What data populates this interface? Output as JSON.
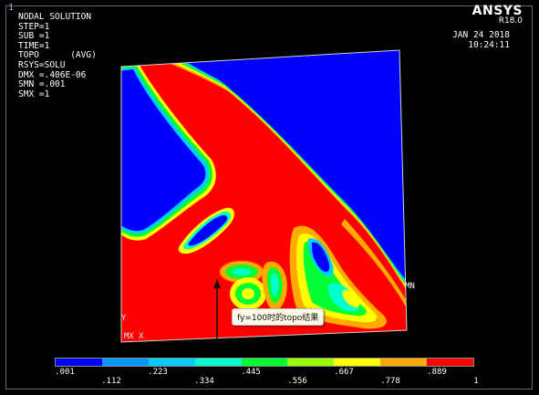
{
  "window_number": "1",
  "info_lines": [
    "NODAL SOLUTION",
    "",
    "STEP=1",
    "SUB =1",
    "TIME=1",
    "TOPO      (AVG)",
    "RSYS=SOLU",
    "DMX =.406E-06",
    "SMN =.001",
    "SMX =1"
  ],
  "brand": {
    "name": "ANSYS",
    "version": "R18.0"
  },
  "date": "JAN 24 2018",
  "time": "10:24:11",
  "labels": {
    "mn": "MN",
    "axis_y": "Y",
    "axis_mx": "MX",
    "axis_x": "X"
  },
  "annotation": "fy=100时的topo结果",
  "legend": {
    "colors": [
      "#0000ff",
      "#0099ff",
      "#00ccff",
      "#00ffcc",
      "#00ff33",
      "#99ff00",
      "#ffff00",
      "#ffaa00",
      "#ff0000"
    ],
    "top_ticks": [
      ".001",
      ".223",
      ".445",
      ".667",
      ".889"
    ],
    "bottom_ticks": [
      ".112",
      ".334",
      ".556",
      ".778",
      "1"
    ]
  }
}
